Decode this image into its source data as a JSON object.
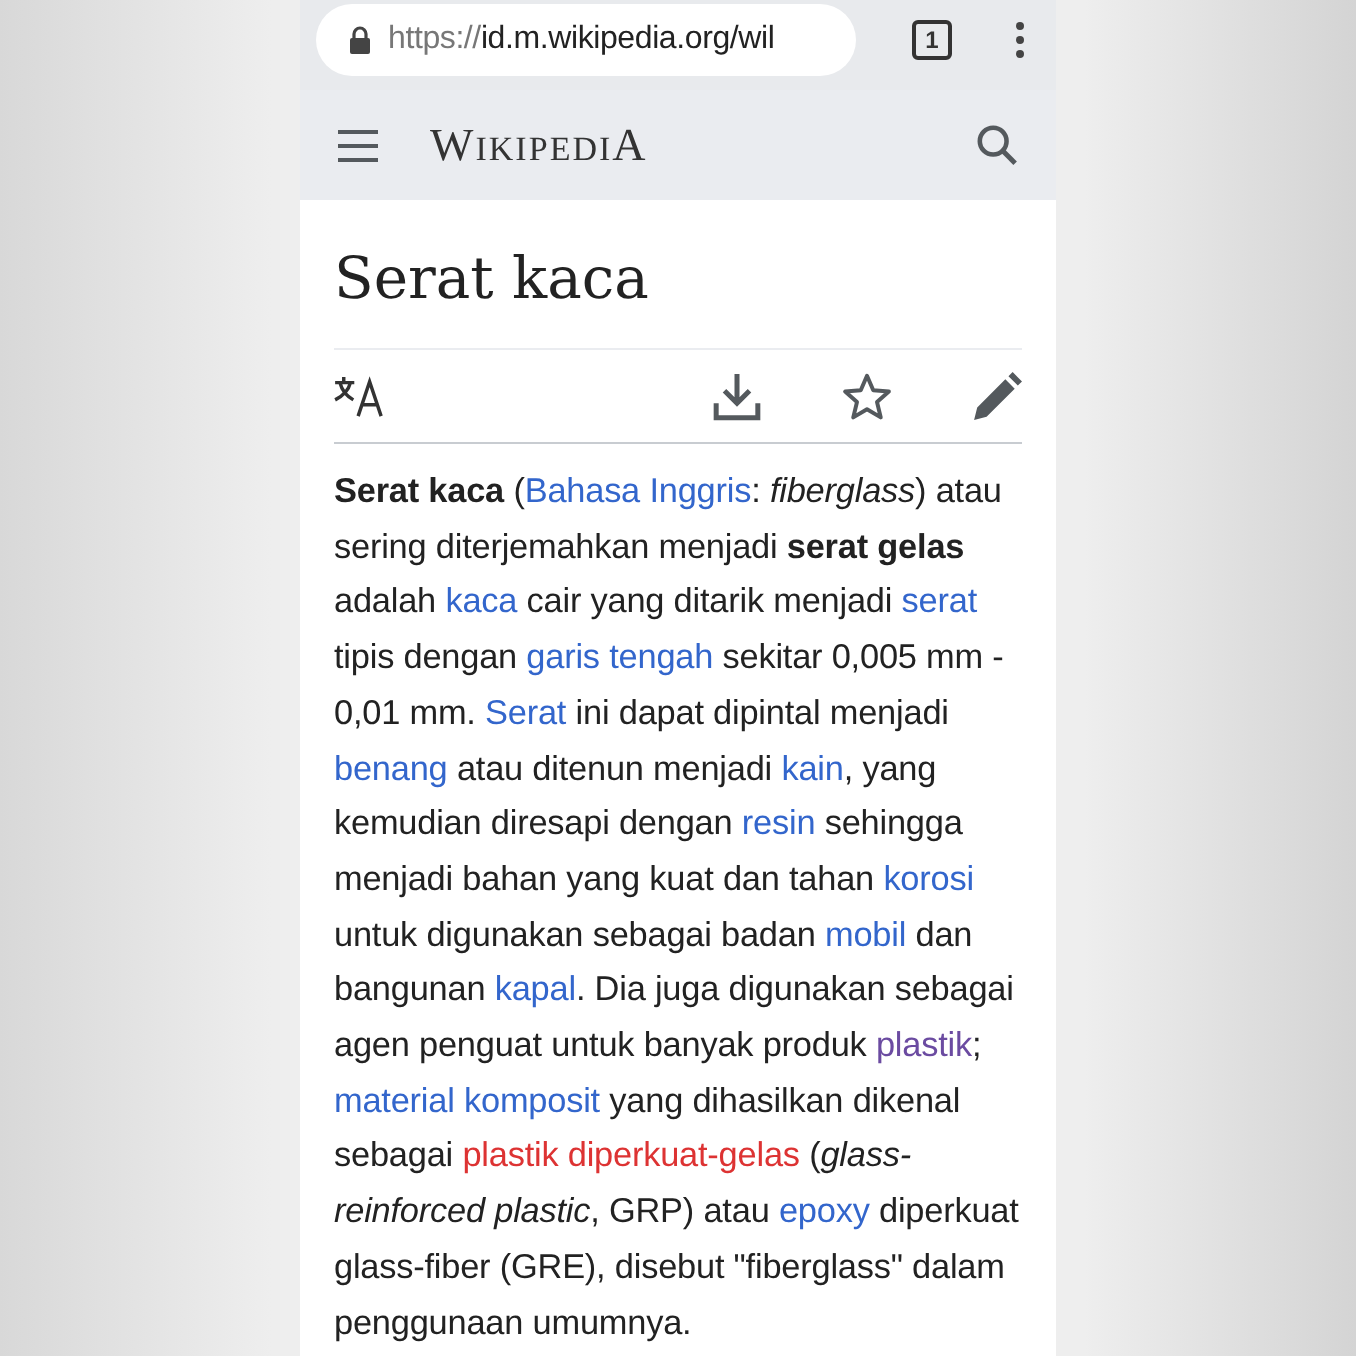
{
  "browser": {
    "url_scheme": "https://",
    "url_rest": "id.m.wikipedia.org/wil",
    "tab_count": "1"
  },
  "header": {
    "logo": "WIKIPEDIA"
  },
  "article": {
    "title": "Serat kaca",
    "paragraph": [
      {
        "kind": "bold",
        "text": "Serat kaca"
      },
      {
        "kind": "plain",
        "text": " ("
      },
      {
        "kind": "link",
        "visited": false,
        "missing": false,
        "text": "Bahasa Inggris"
      },
      {
        "kind": "plain",
        "text": ": "
      },
      {
        "kind": "italic",
        "text": "fiberglass"
      },
      {
        "kind": "plain",
        "text": ") atau sering diterjemahkan menjadi "
      },
      {
        "kind": "bold",
        "text": "serat gelas"
      },
      {
        "kind": "plain",
        "text": " adalah "
      },
      {
        "kind": "link",
        "visited": false,
        "missing": false,
        "text": "kaca"
      },
      {
        "kind": "plain",
        "text": " cair yang ditarik menjadi "
      },
      {
        "kind": "link",
        "visited": false,
        "missing": false,
        "text": "serat"
      },
      {
        "kind": "plain",
        "text": " tipis dengan "
      },
      {
        "kind": "link",
        "visited": false,
        "missing": false,
        "text": "garis tengah"
      },
      {
        "kind": "plain",
        "text": " sekitar 0,005 mm - 0,01 mm. "
      },
      {
        "kind": "link",
        "visited": false,
        "missing": false,
        "text": "Serat"
      },
      {
        "kind": "plain",
        "text": " ini dapat dipintal menjadi "
      },
      {
        "kind": "link",
        "visited": false,
        "missing": false,
        "text": "benang"
      },
      {
        "kind": "plain",
        "text": " atau ditenun menjadi "
      },
      {
        "kind": "link",
        "visited": false,
        "missing": false,
        "text": "kain"
      },
      {
        "kind": "plain",
        "text": ", yang kemudian diresapi dengan "
      },
      {
        "kind": "link",
        "visited": false,
        "missing": false,
        "text": "resin"
      },
      {
        "kind": "plain",
        "text": " sehingga menjadi bahan yang kuat dan tahan "
      },
      {
        "kind": "link",
        "visited": false,
        "missing": false,
        "text": "korosi"
      },
      {
        "kind": "plain",
        "text": " untuk digunakan sebagai badan "
      },
      {
        "kind": "link",
        "visited": false,
        "missing": false,
        "text": "mobil"
      },
      {
        "kind": "plain",
        "text": " dan bangunan "
      },
      {
        "kind": "link",
        "visited": false,
        "missing": false,
        "text": "kapal"
      },
      {
        "kind": "plain",
        "text": ". Dia juga digunakan sebagai agen penguat untuk banyak produk "
      },
      {
        "kind": "link",
        "visited": true,
        "missing": false,
        "text": "plastik"
      },
      {
        "kind": "plain",
        "text": "; "
      },
      {
        "kind": "link",
        "visited": false,
        "missing": false,
        "text": "material komposit"
      },
      {
        "kind": "plain",
        "text": " yang dihasilkan dikenal sebagai "
      },
      {
        "kind": "link",
        "visited": false,
        "missing": true,
        "text": "plastik diperkuat-gelas"
      },
      {
        "kind": "plain",
        "text": " ("
      },
      {
        "kind": "italic",
        "text": "glass-reinforced plastic"
      },
      {
        "kind": "plain",
        "text": ", GRP) atau "
      },
      {
        "kind": "link",
        "visited": false,
        "missing": false,
        "text": "epoxy"
      },
      {
        "kind": "plain",
        "text": " diperkuat glass-fiber (GRE), disebut \"fiberglass\" dalam penggunaan umumnya."
      }
    ]
  }
}
